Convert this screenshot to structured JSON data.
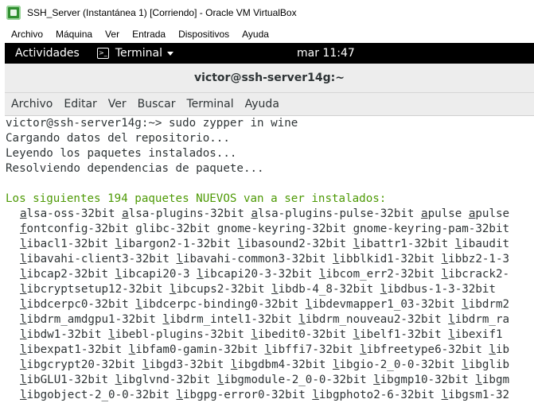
{
  "vbox": {
    "title": "SSH_Server (Instantánea 1) [Corriendo] - Oracle VM VirtualBox",
    "menu": [
      "Archivo",
      "Máquina",
      "Ver",
      "Entrada",
      "Dispositivos",
      "Ayuda"
    ]
  },
  "gnome": {
    "activities": "Actividades",
    "app": "Terminal",
    "clock": "mar 11:47"
  },
  "terminal": {
    "title": "victor@ssh-server14g:~",
    "menu": [
      "Archivo",
      "Editar",
      "Ver",
      "Buscar",
      "Terminal",
      "Ayuda"
    ],
    "output": [
      "victor@ssh-server14g:~> sudo zypper in wine",
      "Cargando datos del repositorio...",
      "Leyendo los paquetes instalados...",
      "Resolviendo dependencias de paquete...",
      "",
      "Los siguientes 194 paquetes NUEVOS van a ser instalados:"
    ],
    "packages": [
      [
        "alsa-oss-32bit",
        "alsa-plugins-32bit",
        "alsa-plugins-pulse-32bit",
        "apulse",
        "apulse"
      ],
      [
        "fontconfig-32bit",
        "glibc-32bit",
        "gnome-keyring-32bit",
        "gnome-keyring-pam-32bit"
      ],
      [
        "libacl1-32bit",
        "libargon2-1-32bit",
        "libasound2-32bit",
        "libattr1-32bit",
        "libaudit"
      ],
      [
        "libavahi-client3-32bit",
        "libavahi-common3-32bit",
        "libblkid1-32bit",
        "libbz2-1-3"
      ],
      [
        "libcap2-32bit",
        "libcapi20-3",
        "libcapi20-3-32bit",
        "libcom_err2-32bit",
        "libcrack2-"
      ],
      [
        "libcryptsetup12-32bit",
        "libcups2-32bit",
        "libdb-4_8-32bit",
        "libdbus-1-3-32bit"
      ],
      [
        "libdcerpc0-32bit",
        "libdcerpc-binding0-32bit",
        "libdevmapper1_03-32bit",
        "libdrm2"
      ],
      [
        "libdrm_amdgpu1-32bit",
        "libdrm_intel1-32bit",
        "libdrm_nouveau2-32bit",
        "libdrm_ra"
      ],
      [
        "libdw1-32bit",
        "libebl-plugins-32bit",
        "libedit0-32bit",
        "libelf1-32bit",
        "libexif1"
      ],
      [
        "libexpat1-32bit",
        "libfam0-gamin-32bit",
        "libffi7-32bit",
        "libfreetype6-32bit",
        "lib"
      ],
      [
        "libgcrypt20-32bit",
        "libgd3-32bit",
        "libgdbm4-32bit",
        "libgio-2_0-0-32bit",
        "libglib"
      ],
      [
        "libGLU1-32bit",
        "libglvnd-32bit",
        "libgmodule-2_0-0-32bit",
        "libgmp10-32bit",
        "libgm"
      ],
      [
        "libgobject-2_0-0-32bit",
        "libgpg-error0-32bit",
        "libgphoto2-6-32bit",
        "libgsm1-32"
      ]
    ]
  }
}
